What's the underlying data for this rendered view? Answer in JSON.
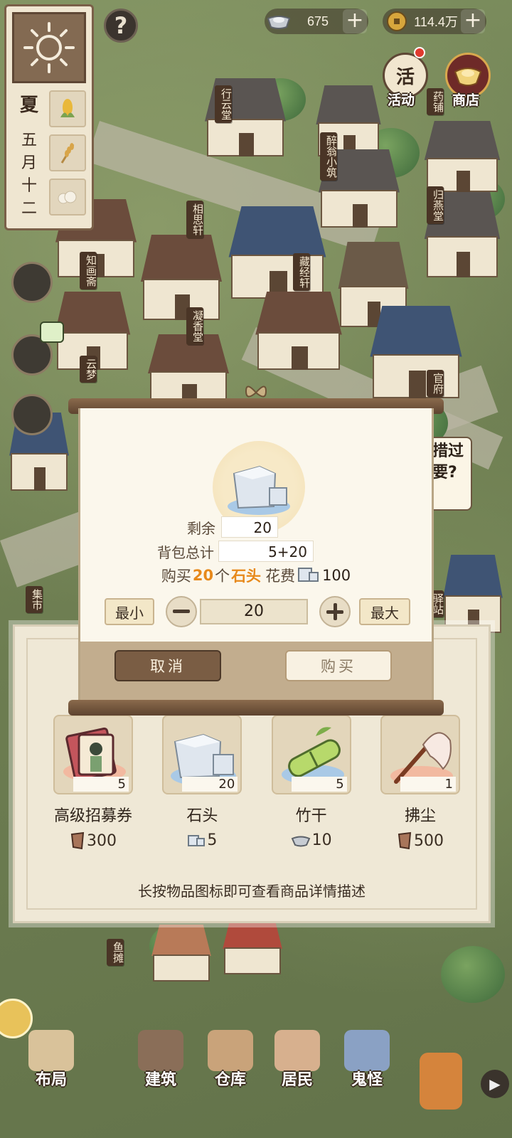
{
  "currencies": {
    "silver": {
      "value": "675",
      "icon": "silver-ingot-icon"
    },
    "coin": {
      "value": "114.4万",
      "icon": "copper-coin-icon"
    }
  },
  "calendar": {
    "season": "夏",
    "date_chars": [
      "五",
      "月",
      "十",
      "二"
    ]
  },
  "top_buttons": {
    "activity": "活动",
    "activity_badge": "活",
    "shop": "商店"
  },
  "buildings": [
    "行云堂",
    "醉翁小筑",
    "药铺",
    "归燕堂",
    "相思轩",
    "知画斋",
    "藏经轩",
    "凝香堂",
    "云梦",
    "官府",
    "集市",
    "驿站",
    "鱼摊"
  ],
  "speech_text": "措过要?",
  "dialog": {
    "remaining_label": "剩余",
    "remaining_value": "20",
    "bag_label": "背包总计",
    "bag_value": "5+20",
    "summary_prefix": "购买",
    "summary_qty": "20",
    "summary_unit": "个",
    "summary_item": "石头",
    "summary_cost_label": "花费",
    "summary_cost": "100",
    "min_label": "最小",
    "max_label": "最大",
    "quantity": "20",
    "cancel_label": "取消",
    "buy_label": "购买"
  },
  "shop": {
    "items": [
      {
        "name": "高级招募券",
        "count": "5",
        "price": "300",
        "price_icon": "token-icon"
      },
      {
        "name": "石头",
        "count": "20",
        "price": "5",
        "price_icon": "stone-currency-icon"
      },
      {
        "name": "竹干",
        "count": "5",
        "price": "10",
        "price_icon": "silver-ingot-icon"
      },
      {
        "name": "拂尘",
        "count": "1",
        "price": "500",
        "price_icon": "token-icon"
      }
    ],
    "hint": "长按物品图标即可查看商品详情描述"
  },
  "nav": {
    "items": [
      "布局",
      "建筑",
      "仓库",
      "居民",
      "鬼怪"
    ]
  },
  "colors": {
    "accent": "#e7891b",
    "panel": "#efe8d6",
    "wood": "#5e4430"
  }
}
